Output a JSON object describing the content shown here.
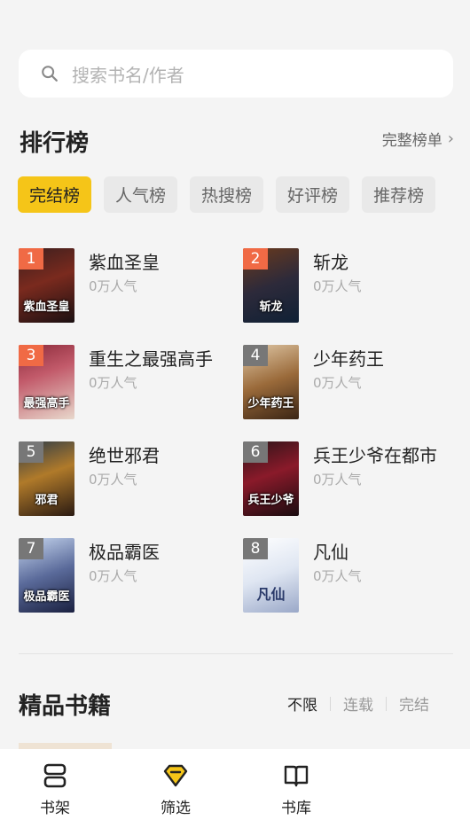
{
  "search": {
    "placeholder": "搜索书名/作者"
  },
  "ranking": {
    "title": "排行榜",
    "more_label": "完整榜单",
    "tabs": [
      {
        "label": "完结榜",
        "active": true
      },
      {
        "label": "人气榜",
        "active": false
      },
      {
        "label": "热搜榜",
        "active": false
      },
      {
        "label": "好评榜",
        "active": false
      },
      {
        "label": "推荐榜",
        "active": false
      }
    ],
    "books": [
      {
        "rank": "1",
        "name": "紫血圣皇",
        "popularity": "0万人气",
        "cover_title": "紫血圣皇"
      },
      {
        "rank": "2",
        "name": "斩龙",
        "popularity": "0万人气",
        "cover_title": "斩龙"
      },
      {
        "rank": "3",
        "name": "重生之最强高手",
        "popularity": "0万人气",
        "cover_title": "最强高手"
      },
      {
        "rank": "4",
        "name": "少年药王",
        "popularity": "0万人气",
        "cover_title": "少年药王"
      },
      {
        "rank": "5",
        "name": "绝世邪君",
        "popularity": "0万人气",
        "cover_title": "邪君"
      },
      {
        "rank": "6",
        "name": "兵王少爷在都市",
        "popularity": "0万人气",
        "cover_title": "兵王少爷"
      },
      {
        "rank": "7",
        "name": "极品霸医",
        "popularity": "0万人气",
        "cover_title": "极品霸医"
      },
      {
        "rank": "8",
        "name": "凡仙",
        "popularity": "0万人气",
        "cover_title": "凡仙"
      }
    ]
  },
  "featured": {
    "title": "精品书籍",
    "filters": [
      {
        "label": "不限",
        "active": true
      },
      {
        "label": "连载",
        "active": false
      },
      {
        "label": "完结",
        "active": false
      }
    ]
  },
  "tabbar": {
    "items": [
      {
        "label": "书架",
        "icon": "bookshelf-icon"
      },
      {
        "label": "筛选",
        "icon": "diamond-filter-icon"
      },
      {
        "label": "书库",
        "icon": "open-book-icon"
      }
    ]
  },
  "colors": {
    "accent": "#f5c518",
    "rank_top3": "#f06a45",
    "rank_other": "#777777"
  }
}
